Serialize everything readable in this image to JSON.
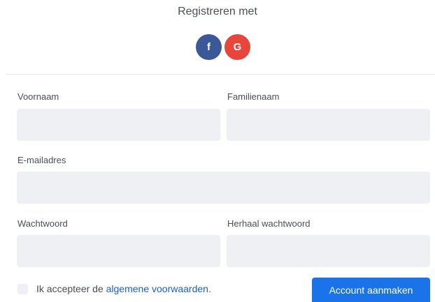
{
  "header": {
    "title": "Registreren met"
  },
  "social": {
    "facebook_glyph": "f",
    "google_glyph": "G",
    "facebook_color": "#3b5998",
    "google_color": "#e8453c"
  },
  "form": {
    "first_name": {
      "label": "Voornaam",
      "value": ""
    },
    "last_name": {
      "label": "Familienaam",
      "value": ""
    },
    "email": {
      "label": "E-mailadres",
      "value": ""
    },
    "password": {
      "label": "Wachtwoord",
      "value": ""
    },
    "password_repeat": {
      "label": "Herhaal wachtwoord",
      "value": ""
    }
  },
  "consent": {
    "prefix": "Ik accepteer de ",
    "link_text": "algemene voorwaarden",
    "suffix": ".",
    "checked": false
  },
  "submit": {
    "label": "Account aanmaken",
    "color": "#1a73e8"
  }
}
